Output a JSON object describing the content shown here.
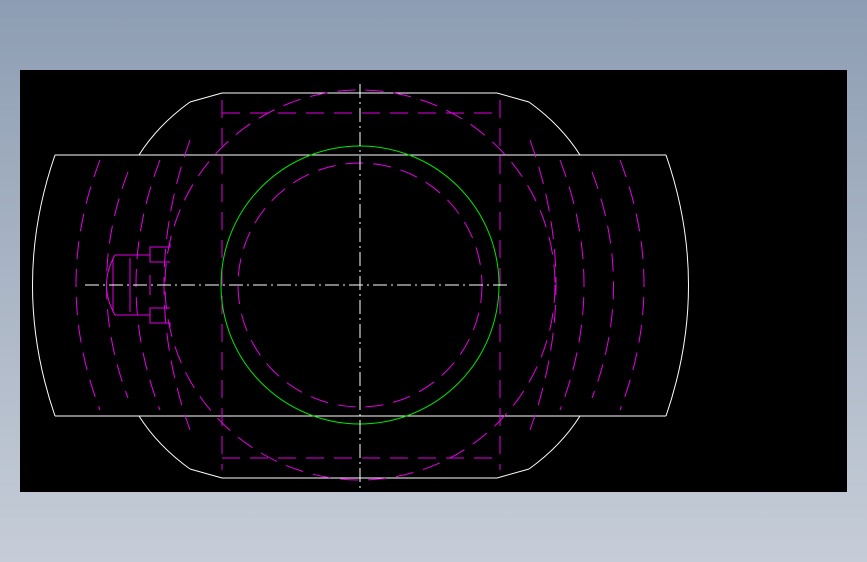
{
  "viewport": {
    "background": "#000000"
  },
  "colors": {
    "visible_edges": "#ffffff",
    "bore_circle": "#00e600",
    "hidden_lines": "#e600e6",
    "center_lines": "#ffffff",
    "frame_gradient_top": "#8d9db3",
    "frame_gradient_bottom": "#c6cdd8"
  }
}
